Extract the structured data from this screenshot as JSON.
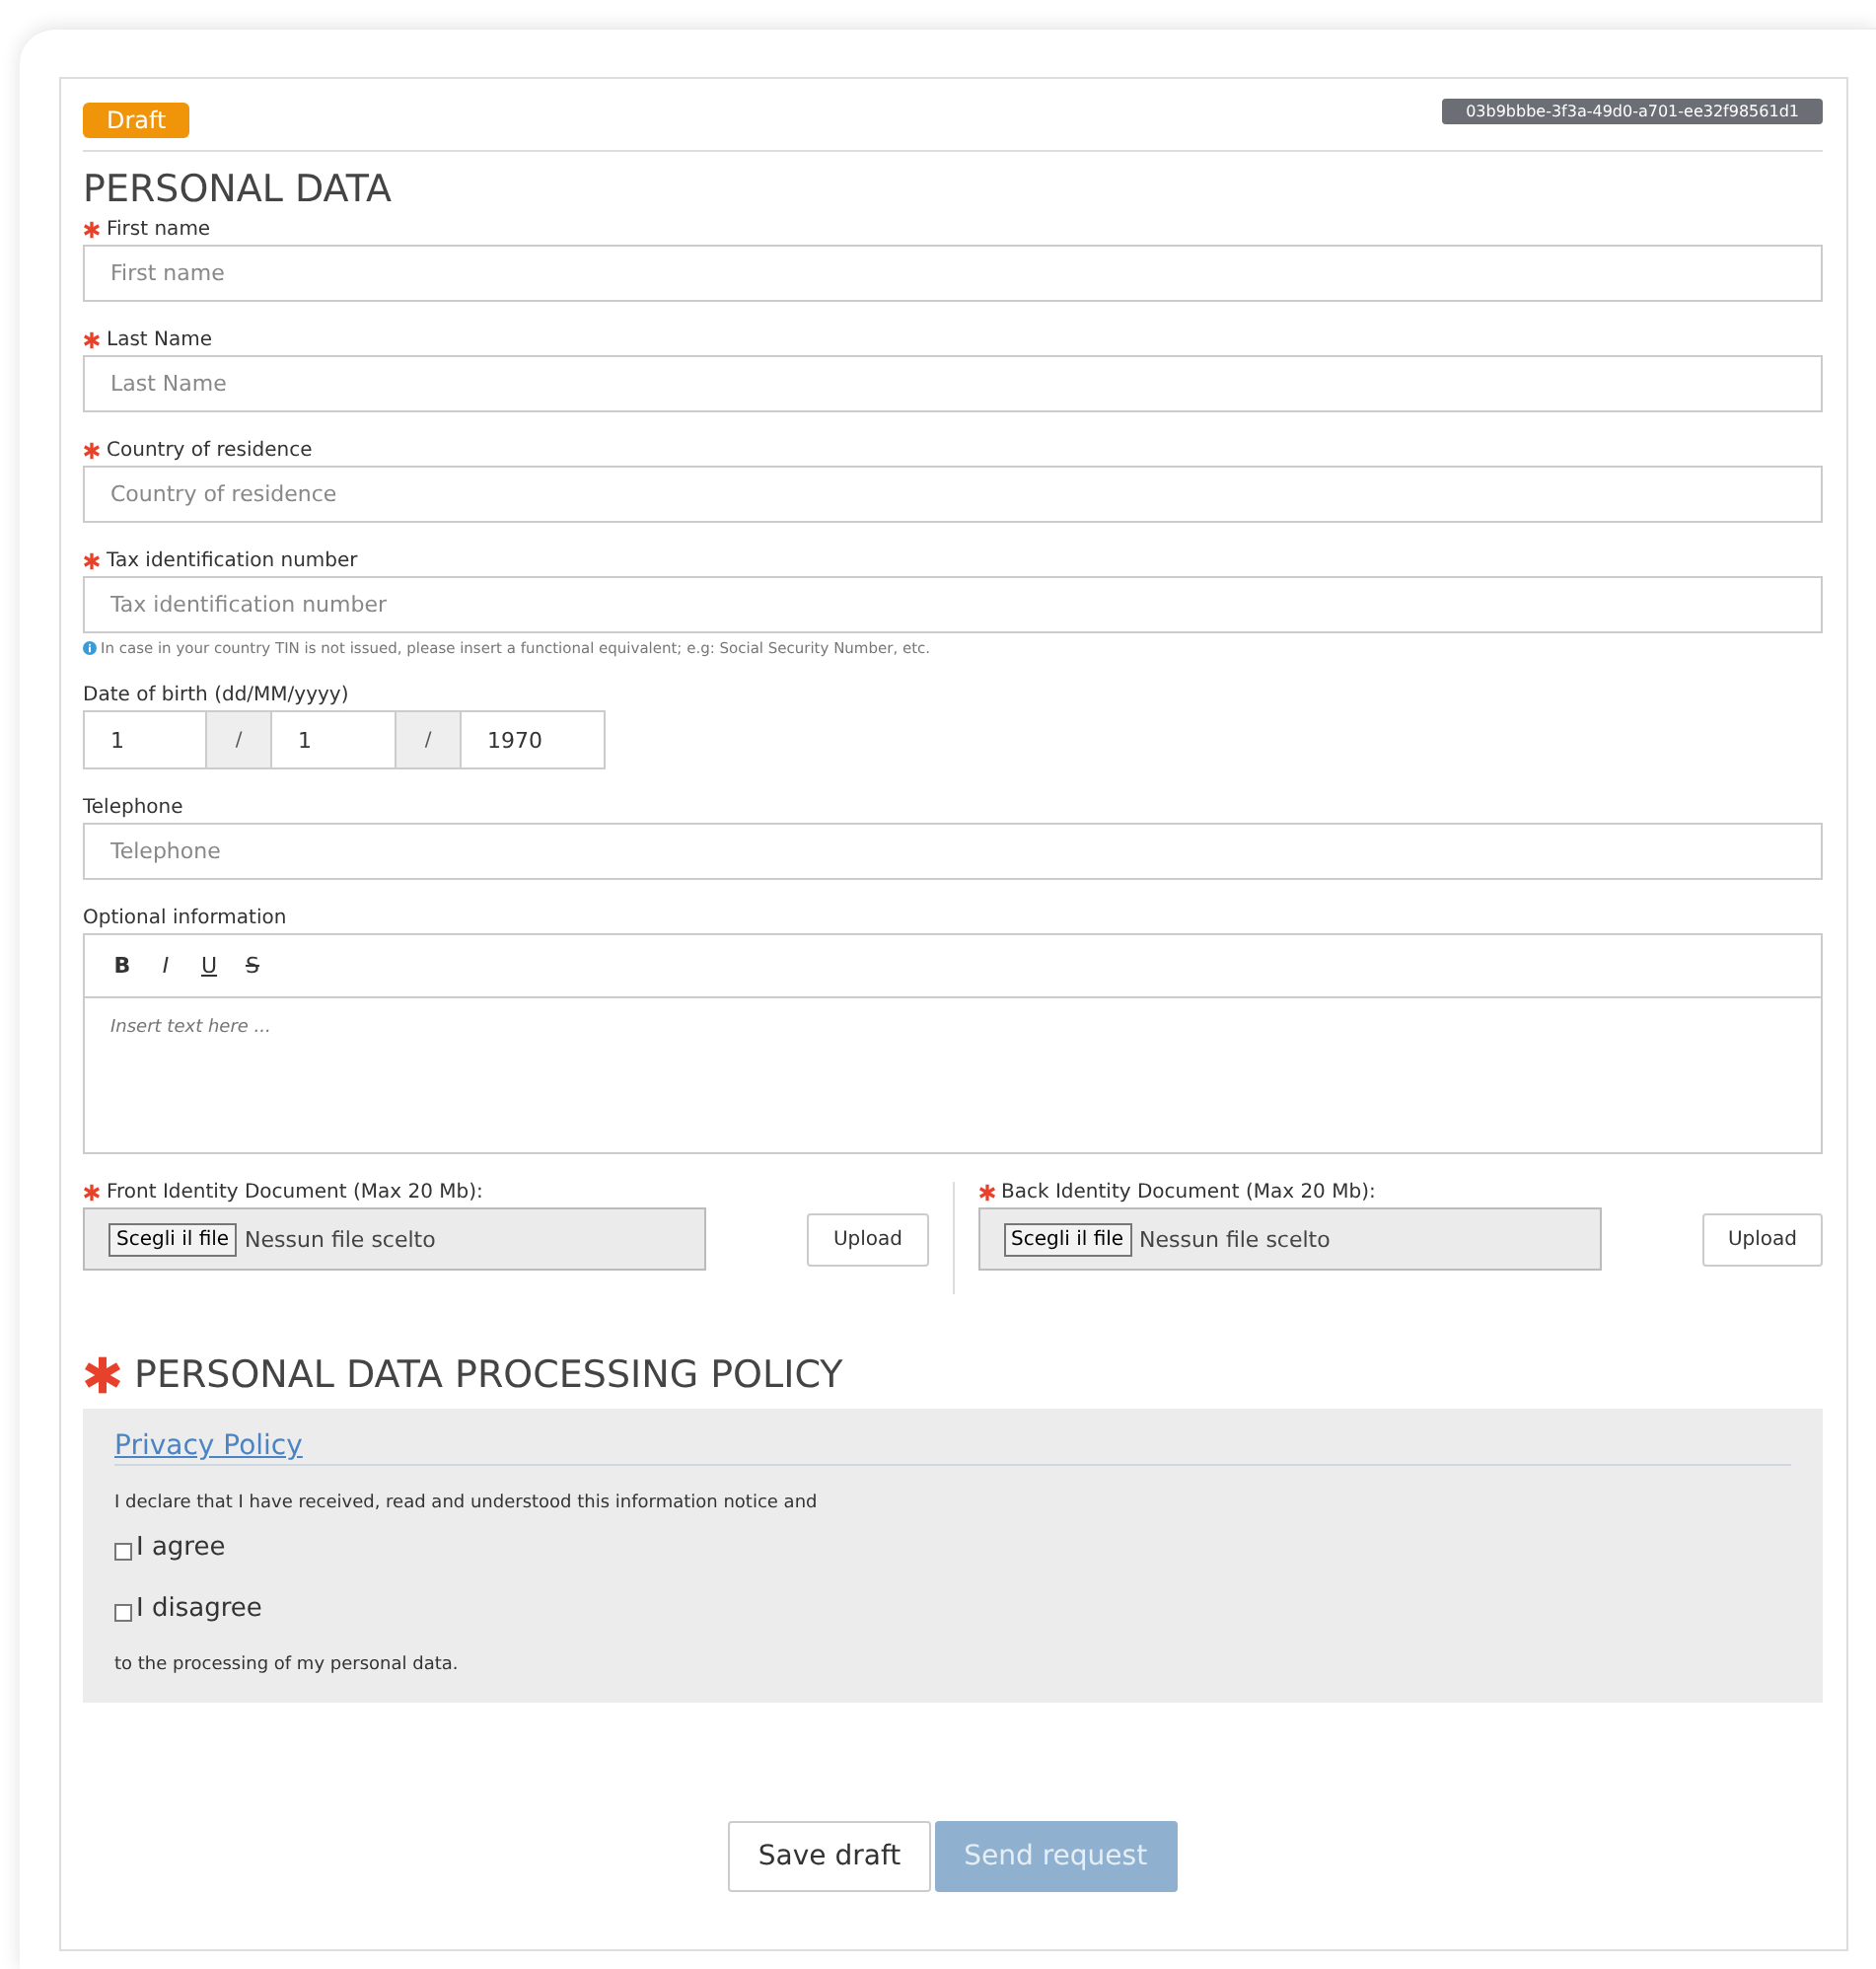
{
  "status_badge": "Draft",
  "request_id": "03b9bbbe-3f3a-49d0-a701-ee32f98561d1",
  "section_title": "PERSONAL DATA",
  "fields": [
    {
      "kind": "text",
      "label": "First name",
      "required": true,
      "placeholder": "First name"
    },
    {
      "kind": "text",
      "label": "Last Name",
      "required": true,
      "placeholder": "Last Name"
    },
    {
      "kind": "text",
      "label": "Country of residence",
      "required": true,
      "placeholder": "Country of residence"
    },
    {
      "kind": "text",
      "label": "Tax identification number",
      "required": true,
      "placeholder": "Tax identification number",
      "hint": "In case in your country TIN is not issued, please insert a functional equivalent; e.g: Social Security Number, etc."
    },
    {
      "kind": "date",
      "label": "Date of birth (dd/MM/yyyy)",
      "required": false,
      "day": "1",
      "separator_1": "/",
      "month": "1",
      "separator_2": "/",
      "year": "1970"
    },
    {
      "kind": "text",
      "label": "Telephone",
      "required": false,
      "placeholder": "Telephone"
    },
    {
      "kind": "richtext",
      "label": "Optional information",
      "required": false,
      "toolbar": [
        "B",
        "I",
        "U",
        "S"
      ],
      "placeholder": "Insert text here ..."
    }
  ],
  "uploads": [
    {
      "label": "Front Identity Document (Max 20 Mb):",
      "required": true,
      "choose_button": "Scegli il file",
      "file_status": "Nessun file scelto",
      "upload_button": "Upload"
    },
    {
      "label": "Back Identity Document (Max 20 Mb):",
      "required": true,
      "choose_button": "Scegli il file",
      "file_status": "Nessun file scelto",
      "upload_button": "Upload"
    }
  ],
  "policy": {
    "title": "PERSONAL DATA PROCESSING POLICY",
    "required": true,
    "link": "Privacy Policy",
    "declaration": "I declare that I have received, read and understood this information notice and",
    "options": [
      {
        "label": "I agree",
        "checked": false
      },
      {
        "label": "I disagree",
        "checked": false
      }
    ],
    "closing": "to the processing of my personal data."
  },
  "buttons": [
    {
      "label": "Save draft",
      "disabled": false,
      "kind": "secondary"
    },
    {
      "label": "Send request",
      "disabled": true,
      "kind": "primary"
    }
  ]
}
